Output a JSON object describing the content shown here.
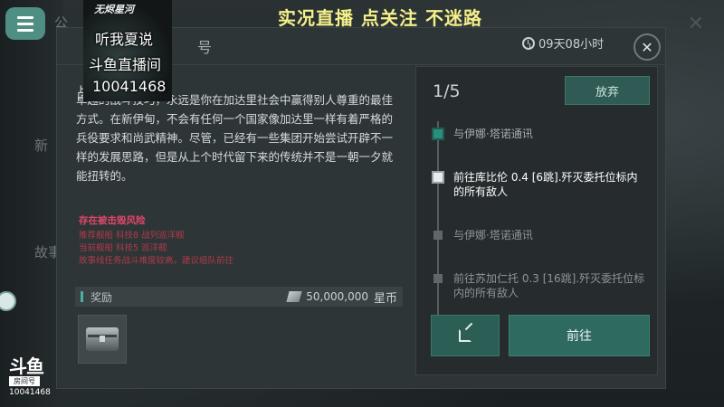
{
  "stream": {
    "banner": "实况直播 点关注 不迷路",
    "overlay_logo": "无烬星河",
    "overlay_lines": [
      "听我夏说",
      "斗鱼直播间",
      "10041468"
    ],
    "douyu_logo": "斗鱼",
    "douyu_room_label": "房间号",
    "douyu_room_number": "10041468"
  },
  "background": {
    "ghost_texts": [
      "新",
      "故事",
      "公",
      "号"
    ]
  },
  "modal": {
    "mission_tag": "战",
    "timer": "09天08小时",
    "close_label": "✕",
    "description": "卓越的战斗技巧，永远是你在加达里社会中赢得别人尊重的最佳方式。在新伊甸，不会有任何一个国家像加达里一样有着严格的兵役要求和尚武精神。尽管，已经有一些集团开始尝试开辟不一样的发展思路，但是从上个时代留下来的传统并不是一朝一夕就能扭转的。",
    "risk": {
      "title": "存在被击毁风险",
      "lines": [
        "推荐舰船  科技8 战列巡洋舰",
        "当前舰船  科技5 巡洋舰",
        "故事线任务战斗难度较高，建议组队前往"
      ]
    },
    "reward": {
      "label": "奖励",
      "value": "50,000,000",
      "unit": "星币"
    }
  },
  "steps_panel": {
    "progress": "1/5",
    "abandon_label": "放弃",
    "steps": [
      {
        "text": "与伊娜·塔诺通讯",
        "state": "done"
      },
      {
        "text": "前往库比伦 0.4 [6跳].歼灭委托位标内的所有敌人",
        "state": "active"
      },
      {
        "text": "与伊娜·塔诺通讯",
        "state": "pending"
      },
      {
        "text": "前往苏加仁托 0.3 [16跳].歼灭委托位标内的所有敌人",
        "state": "pending"
      }
    ],
    "go_label": "前往"
  }
}
